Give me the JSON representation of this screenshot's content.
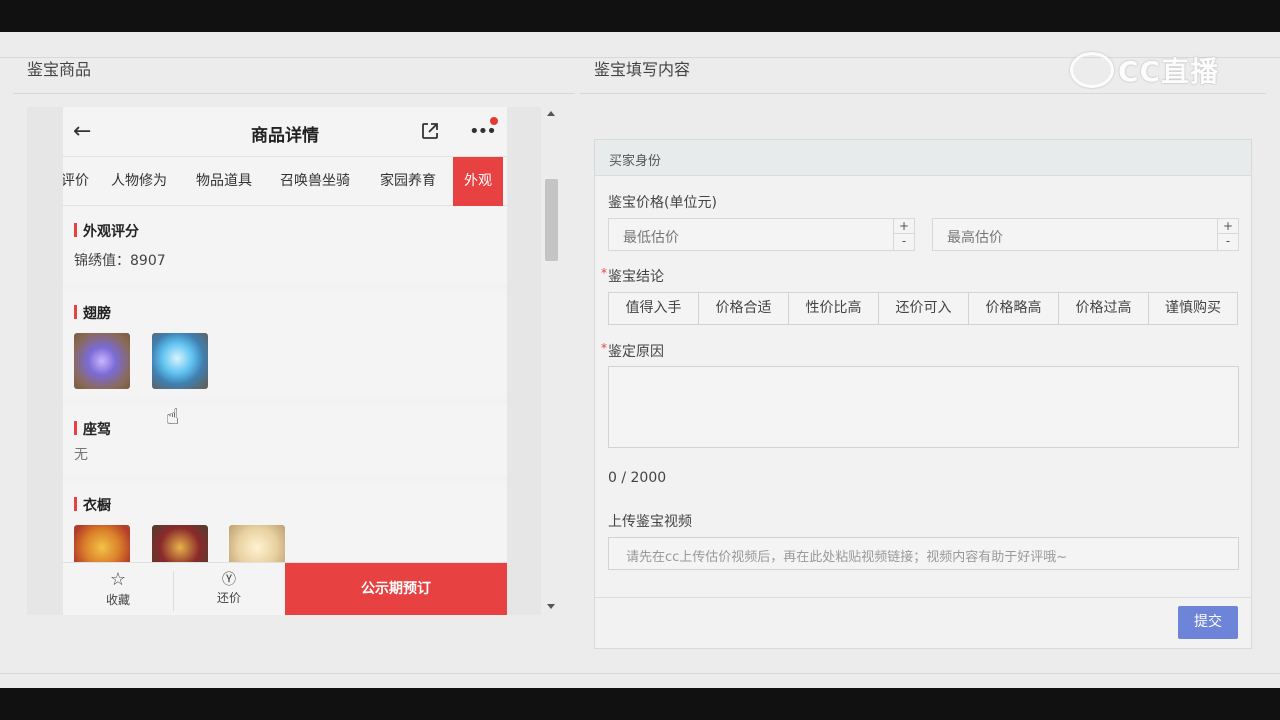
{
  "left_section": {
    "title": "鉴宝商品"
  },
  "right_section": {
    "title": "鉴宝填写内容"
  },
  "watermark": {
    "text": "CC直播"
  },
  "phone": {
    "header": {
      "title": "商品详情"
    },
    "tabs": [
      "评价",
      "人物修为",
      "物品道具",
      "召唤兽坐骑",
      "家园养育",
      "外观"
    ],
    "active_tab": "外观",
    "cards": {
      "appearance_score": {
        "title": "外观评分",
        "text": "锦绣值：8907"
      },
      "wings": {
        "title": "翅膀"
      },
      "mount": {
        "title": "座驾",
        "text": "无"
      },
      "wardrobe": {
        "title": "衣橱"
      }
    },
    "footer": {
      "favorite": "收藏",
      "counter_offer": "还价",
      "buy": "公示期预订"
    }
  },
  "form": {
    "head": "买家身份",
    "price_label": "鉴宝价格(单位元)",
    "min_placeholder": "最低估价",
    "max_placeholder": "最高估价",
    "step_plus": "+",
    "step_minus": "-",
    "conclusion_label": "鉴宝结论",
    "conclusions": [
      "值得入手",
      "价格合适",
      "性价比高",
      "还价可入",
      "价格略高",
      "价格过高",
      "谨慎购买"
    ],
    "reason_label": "鉴定原因",
    "counter": "0 / 2000",
    "video_label": "上传鉴宝视频",
    "video_placeholder": "请先在cc上传估价视频后，再在此处粘贴视频链接；视频内容有助于好评哦~",
    "submit": "提交",
    "required_mark": "*"
  },
  "colors": {
    "accent_red": "#e84141",
    "submit_blue": "#6d84d8"
  }
}
